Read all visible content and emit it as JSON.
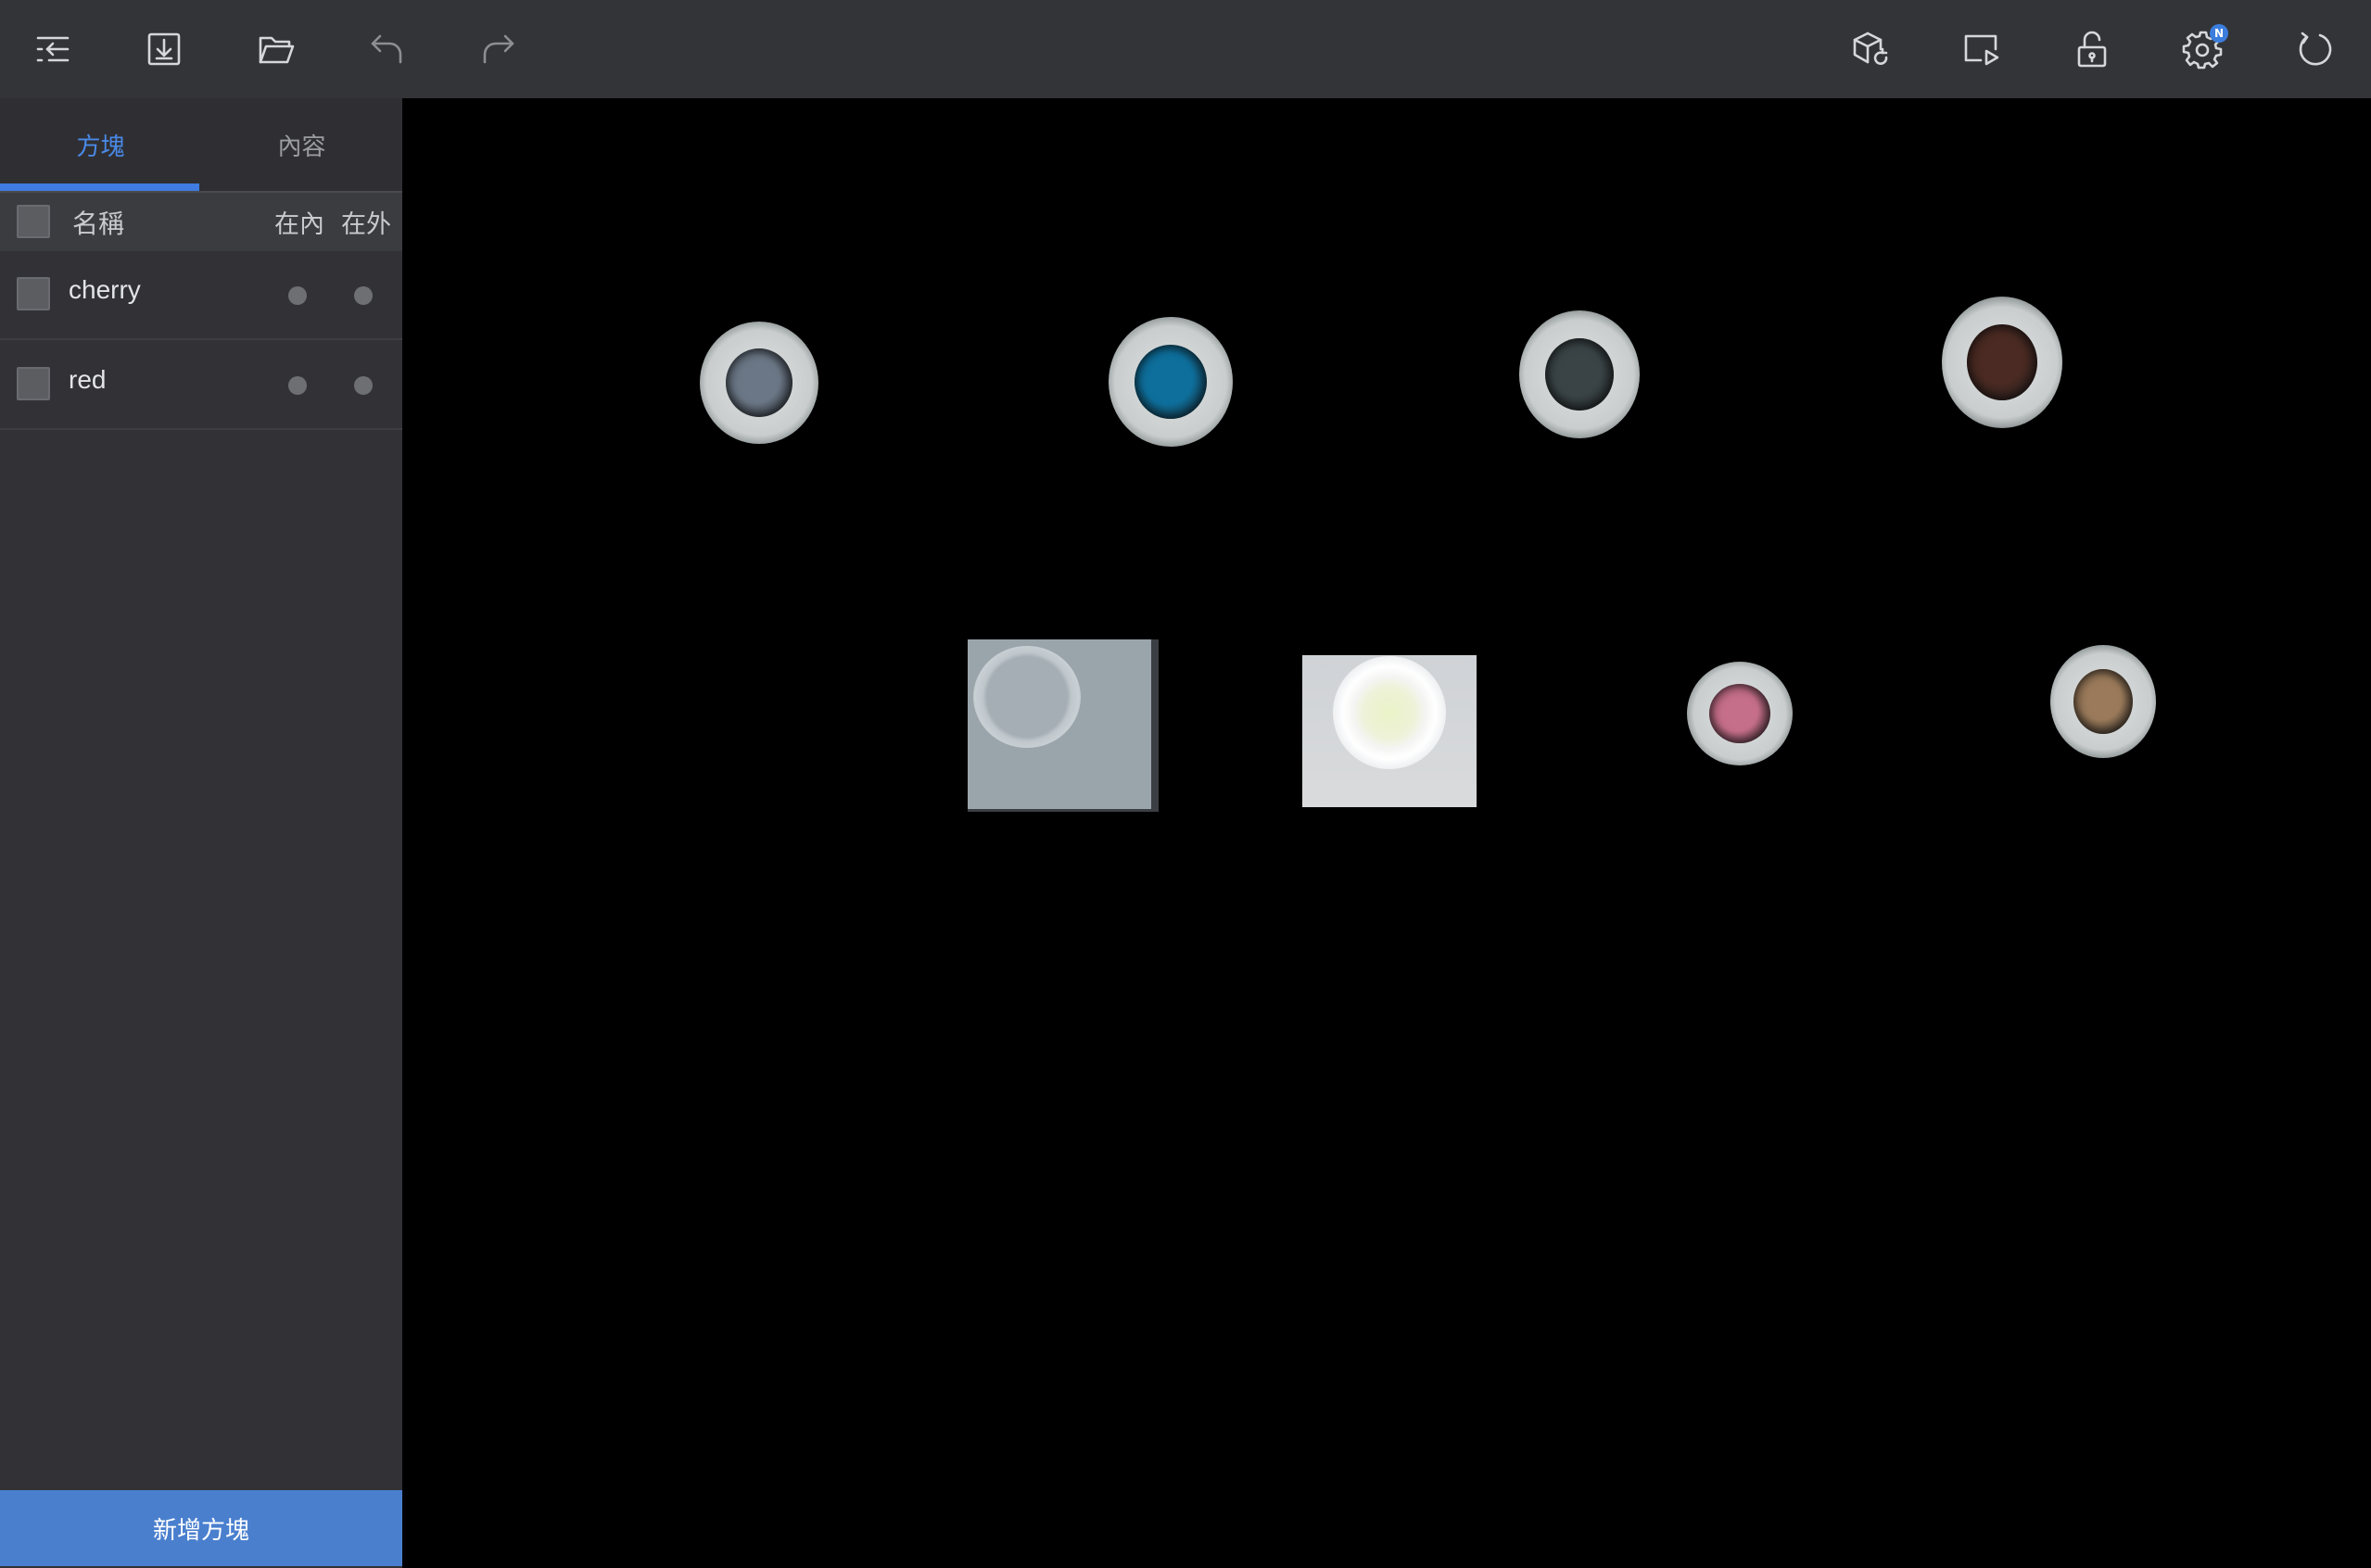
{
  "sidebar": {
    "tabs": [
      {
        "label": "方塊",
        "active": true
      },
      {
        "label": "內容",
        "active": false
      }
    ],
    "columns": {
      "name": "名稱",
      "inside": "在內",
      "outside": "在外"
    },
    "rows": [
      {
        "name": "cherry"
      },
      {
        "name": "red"
      }
    ],
    "add_button_label": "新增方塊"
  },
  "toolbar": {
    "left_icons": [
      "collapse-menu-icon",
      "download-icon",
      "folder-open-icon",
      "undo-icon",
      "redo-icon"
    ],
    "right_icons": [
      "cube-refresh-icon",
      "present-play-icon",
      "unlock-icon",
      "settings-icon",
      "refresh-icon"
    ],
    "settings_badge": "N",
    "accent_color": "#3b7ddd"
  },
  "viewport": {
    "items_count": 8,
    "item_colors": [
      "#6b7786",
      "#0e6f9c",
      "#3a4446",
      "#4a2a22",
      "#b3bcc2",
      "#e7f0c6",
      "#c66f8a",
      "#9a7a5a"
    ]
  }
}
